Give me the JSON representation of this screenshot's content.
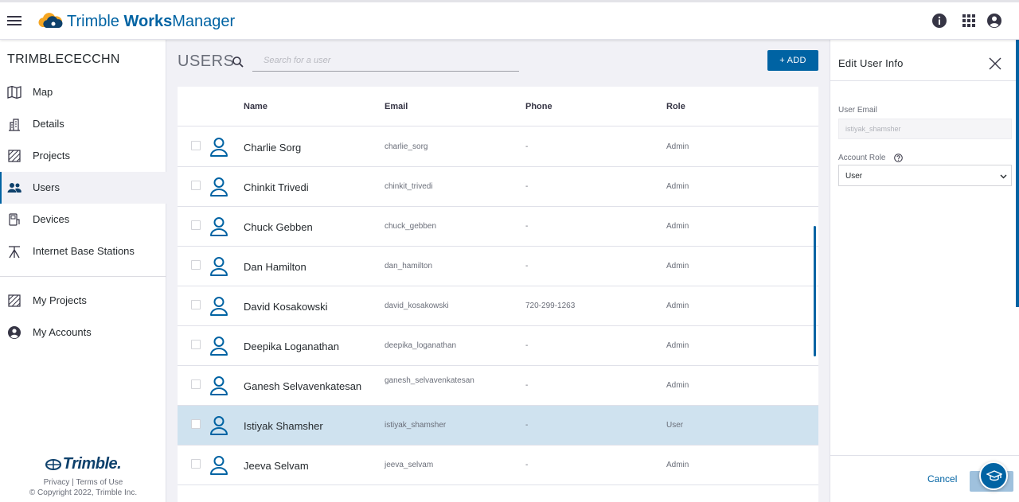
{
  "header": {
    "brand_light": "Trimble ",
    "brand_bold": "Works",
    "brand_rest": "Manager",
    "icons": [
      "menu-icon",
      "info-icon",
      "apps-grid-icon",
      "account-icon"
    ]
  },
  "sidebar": {
    "org_name": "TRIMBLECECCHN",
    "items": [
      {
        "label": "Map",
        "icon": "map-icon"
      },
      {
        "label": "Details",
        "icon": "building-icon"
      },
      {
        "label": "Projects",
        "icon": "projects-icon"
      },
      {
        "label": "Users",
        "icon": "users-icon",
        "active": true
      },
      {
        "label": "Devices",
        "icon": "devices-icon"
      },
      {
        "label": "Internet Base Stations",
        "icon": "base-station-icon"
      }
    ],
    "secondary_items": [
      {
        "label": "My Projects",
        "icon": "projects-icon"
      },
      {
        "label": "My Accounts",
        "icon": "account-icon"
      }
    ],
    "footer": {
      "logo_text": "Trimble.",
      "privacy": "Privacy",
      "separator": "|",
      "terms": "Terms of Use",
      "copyright": "© Copyright 2022, Trimble Inc."
    }
  },
  "main": {
    "title": "USERS",
    "search_placeholder": "Search for a user",
    "add_label": "+ ADD",
    "columns": {
      "name": "Name",
      "email": "Email",
      "phone": "Phone",
      "role": "Role"
    },
    "rows": [
      {
        "name": "Charlie Sorg",
        "email": "charlie_sorg",
        "phone": "-",
        "role": "Admin"
      },
      {
        "name": "Chinkit Trivedi",
        "email": "chinkit_trivedi",
        "phone": "-",
        "role": "Admin"
      },
      {
        "name": "Chuck Gebben",
        "email": "chuck_gebben",
        "phone": "-",
        "role": "Admin"
      },
      {
        "name": "Dan Hamilton",
        "email": "dan_hamilton",
        "phone": "-",
        "role": "Admin"
      },
      {
        "name": "David Kosakowski",
        "email": "david_kosakowski",
        "phone": "720-299-1263",
        "role": "Admin"
      },
      {
        "name": "Deepika Loganathan",
        "email": "deepika_loganathan",
        "phone": "-",
        "role": "Admin"
      },
      {
        "name": "Ganesh Selvavenkatesan",
        "email": "ganesh_selvavenkatesan",
        "phone": "-",
        "role": "Admin"
      },
      {
        "name": "Istiyak Shamsher",
        "email": "istiyak_shamsher",
        "phone": "-",
        "role": "User",
        "selected": true
      },
      {
        "name": "Jeeva Selvam",
        "email": "jeeva_selvam",
        "phone": "-",
        "role": "Admin"
      }
    ]
  },
  "panel": {
    "title": "Edit User Info",
    "email_label": "User Email",
    "email_value": "istiyak_shamsher",
    "role_label": "Account Role",
    "role_value": "User",
    "cancel_label": "Cancel"
  },
  "colors": {
    "brand": "#0063a3",
    "selected_row": "#cfe2ef",
    "background": "#f1f1f6"
  }
}
